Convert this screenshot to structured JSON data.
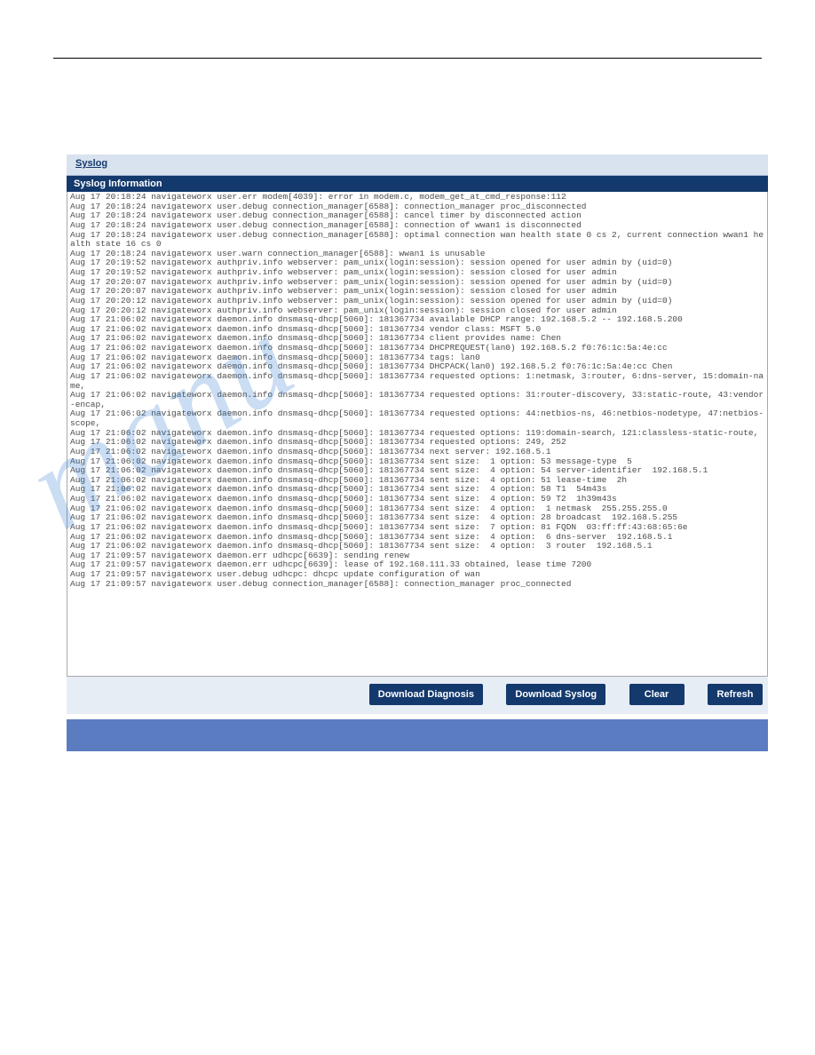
{
  "tab": {
    "label": "Syslog"
  },
  "section": {
    "title": "Syslog Information"
  },
  "buttons": {
    "download_diag": "Download Diagnosis",
    "download_syslog": "Download Syslog",
    "clear": "Clear",
    "refresh": "Refresh"
  },
  "watermark": {
    "text": "manu"
  },
  "log": {
    "lines": [
      "Aug 17 20:18:24 navigateworx user.err modem[4039]: error in modem.c, modem_get_at_cmd_response:112",
      "Aug 17 20:18:24 navigateworx user.debug connection_manager[6588]: connection_manager proc_disconnected",
      "Aug 17 20:18:24 navigateworx user.debug connection_manager[6588]: cancel timer by disconnected action",
      "Aug 17 20:18:24 navigateworx user.debug connection_manager[6588]: connection of wwan1 is disconnected",
      "Aug 17 20:18:24 navigateworx user.debug connection_manager[6588]: optimal connection wan health state 0 cs 2, current connection wwan1 health state 16 cs 0",
      "Aug 17 20:18:24 navigateworx user.warn connection_manager[6588]: wwan1 is unusable",
      "Aug 17 20:19:52 navigateworx authpriv.info webserver: pam_unix(login:session): session opened for user admin by (uid=0)",
      "Aug 17 20:19:52 navigateworx authpriv.info webserver: pam_unix(login:session): session closed for user admin",
      "Aug 17 20:20:07 navigateworx authpriv.info webserver: pam_unix(login:session): session opened for user admin by (uid=0)",
      "Aug 17 20:20:07 navigateworx authpriv.info webserver: pam_unix(login:session): session closed for user admin",
      "Aug 17 20:20:12 navigateworx authpriv.info webserver: pam_unix(login:session): session opened for user admin by (uid=0)",
      "Aug 17 20:20:12 navigateworx authpriv.info webserver: pam_unix(login:session): session closed for user admin",
      "Aug 17 21:06:02 navigateworx daemon.info dnsmasq-dhcp[5060]: 181367734 available DHCP range: 192.168.5.2 -- 192.168.5.200",
      "Aug 17 21:06:02 navigateworx daemon.info dnsmasq-dhcp[5060]: 181367734 vendor class: MSFT 5.0",
      "Aug 17 21:06:02 navigateworx daemon.info dnsmasq-dhcp[5060]: 181367734 client provides name: Chen",
      "Aug 17 21:06:02 navigateworx daemon.info dnsmasq-dhcp[5060]: 181367734 DHCPREQUEST(lan0) 192.168.5.2 f0:76:1c:5a:4e:cc",
      "Aug 17 21:06:02 navigateworx daemon.info dnsmasq-dhcp[5060]: 181367734 tags: lan0",
      "Aug 17 21:06:02 navigateworx daemon.info dnsmasq-dhcp[5060]: 181367734 DHCPACK(lan0) 192.168.5.2 f0:76:1c:5a:4e:cc Chen",
      "Aug 17 21:06:02 navigateworx daemon.info dnsmasq-dhcp[5060]: 181367734 requested options: 1:netmask, 3:router, 6:dns-server, 15:domain-name,",
      "Aug 17 21:06:02 navigateworx daemon.info dnsmasq-dhcp[5060]: 181367734 requested options: 31:router-discovery, 33:static-route, 43:vendor-encap,",
      "Aug 17 21:06:02 navigateworx daemon.info dnsmasq-dhcp[5060]: 181367734 requested options: 44:netbios-ns, 46:netbios-nodetype, 47:netbios-scope,",
      "Aug 17 21:06:02 navigateworx daemon.info dnsmasq-dhcp[5060]: 181367734 requested options: 119:domain-search, 121:classless-static-route,",
      "Aug 17 21:06:02 navigateworx daemon.info dnsmasq-dhcp[5060]: 181367734 requested options: 249, 252",
      "Aug 17 21:06:02 navigateworx daemon.info dnsmasq-dhcp[5060]: 181367734 next server: 192.168.5.1",
      "Aug 17 21:06:02 navigateworx daemon.info dnsmasq-dhcp[5060]: 181367734 sent size:  1 option: 53 message-type  5",
      "Aug 17 21:06:02 navigateworx daemon.info dnsmasq-dhcp[5060]: 181367734 sent size:  4 option: 54 server-identifier  192.168.5.1",
      "Aug 17 21:06:02 navigateworx daemon.info dnsmasq-dhcp[5060]: 181367734 sent size:  4 option: 51 lease-time  2h",
      "Aug 17 21:06:02 navigateworx daemon.info dnsmasq-dhcp[5060]: 181367734 sent size:  4 option: 58 T1  54m43s",
      "Aug 17 21:06:02 navigateworx daemon.info dnsmasq-dhcp[5060]: 181367734 sent size:  4 option: 59 T2  1h39m43s",
      "Aug 17 21:06:02 navigateworx daemon.info dnsmasq-dhcp[5060]: 181367734 sent size:  4 option:  1 netmask  255.255.255.0",
      "Aug 17 21:06:02 navigateworx daemon.info dnsmasq-dhcp[5060]: 181367734 sent size:  4 option: 28 broadcast  192.168.5.255",
      "Aug 17 21:06:02 navigateworx daemon.info dnsmasq-dhcp[5060]: 181367734 sent size:  7 option: 81 FQDN  03:ff:ff:43:68:65:6e",
      "Aug 17 21:06:02 navigateworx daemon.info dnsmasq-dhcp[5060]: 181367734 sent size:  4 option:  6 dns-server  192.168.5.1",
      "Aug 17 21:06:02 navigateworx daemon.info dnsmasq-dhcp[5060]: 181367734 sent size:  4 option:  3 router  192.168.5.1",
      "Aug 17 21:09:57 navigateworx daemon.err udhcpc[6639]: sending renew",
      "Aug 17 21:09:57 navigateworx daemon.err udhcpc[6639]: lease of 192.168.111.33 obtained, lease time 7200",
      "Aug 17 21:09:57 navigateworx user.debug udhcpc: dhcpc update configuration of wan",
      "Aug 17 21:09:57 navigateworx user.debug connection_manager[6588]: connection_manager proc_connected"
    ]
  }
}
